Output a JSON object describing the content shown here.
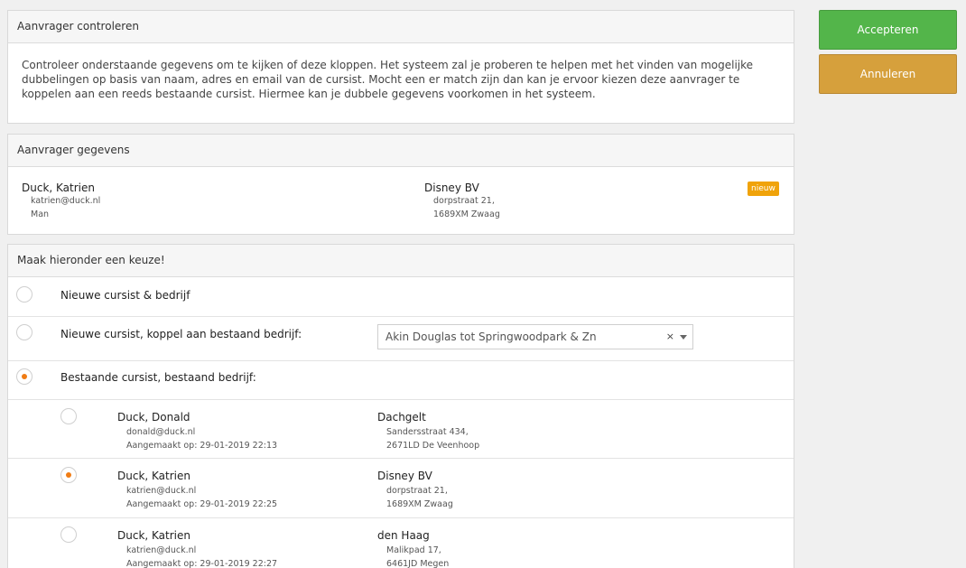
{
  "actions": {
    "accept_label": "Accepteren",
    "cancel_label": "Annuleren"
  },
  "review": {
    "title": "Aanvrager controleren",
    "text": "Controleer onderstaande gegevens om te kijken of deze kloppen. Het systeem zal je proberen te helpen met het vinden van mogelijke dubbelingen op basis van naam, adres en email van de cursist. Mocht een er match zijn dan kan je ervoor kiezen deze aanvrager te koppelen aan een reeds bestaande cursist. Hiermee kan je dubbele gegevens voorkomen in het systeem."
  },
  "applicant": {
    "title": "Aanvrager gegevens",
    "name": "Duck, Katrien",
    "email": "katrien@duck.nl",
    "gender": "Man",
    "company": "Disney BV",
    "street": "dorpstraat 21,",
    "city": "1689XM Zwaag",
    "badge": "nieuw"
  },
  "choice": {
    "title": "Maak hieronder een keuze!",
    "option1_label": "Nieuwe cursist & bedrijf",
    "option2_label": "Nieuwe cursist, koppel aan bestaand bedrijf:",
    "option2_select_value": "Akin Douglas tot Springwoodpark & Zn",
    "option2_clear": "×",
    "option3_label": "Bestaande cursist, bestaand bedrijf:",
    "selected_option": 3
  },
  "matches": [
    {
      "name": "Duck, Donald",
      "email": "donald@duck.nl",
      "created": "Aangemaakt op: 29-01-2019 22:13",
      "company": "Dachgelt",
      "street": "Sandersstraat 434,",
      "city": "2671LD De Veenhoop",
      "selected": false
    },
    {
      "name": "Duck, Katrien",
      "email": "katrien@duck.nl",
      "created": "Aangemaakt op: 29-01-2019 22:25",
      "company": "Disney BV",
      "street": "dorpstraat 21,",
      "city": "1689XM Zwaag",
      "selected": true
    },
    {
      "name": "Duck, Katrien",
      "email": "katrien@duck.nl",
      "created": "Aangemaakt op: 29-01-2019 22:27",
      "company": "den Haag",
      "street": "Malikpad 17,",
      "city": "6461JD Megen",
      "selected": false
    }
  ]
}
